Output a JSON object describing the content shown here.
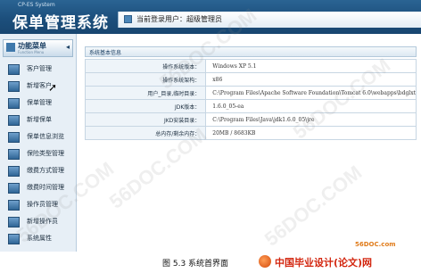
{
  "header": {
    "brand_small": "CP-ES System",
    "app_title": "保单管理系统",
    "current_user_label": "当前登录用户：超级管理员"
  },
  "sidebar": {
    "head_label": "功能菜单",
    "head_sub": "Function Menu",
    "items": [
      {
        "label": "客户管理",
        "icon": "customer-icon"
      },
      {
        "label": "新增客户",
        "icon": "add-customer-icon"
      },
      {
        "label": "保单管理",
        "icon": "policy-icon"
      },
      {
        "label": "新增保单",
        "icon": "add-policy-icon"
      },
      {
        "label": "保单信息浏览",
        "icon": "browse-icon"
      },
      {
        "label": "保险类型管理",
        "icon": "type-icon"
      },
      {
        "label": "缴费方式管理",
        "icon": "payment-icon"
      },
      {
        "label": "缴费时间管理",
        "icon": "schedule-icon"
      },
      {
        "label": "操作员管理",
        "icon": "operator-icon"
      },
      {
        "label": "新增操作员",
        "icon": "add-operator-icon"
      },
      {
        "label": "系统属性",
        "icon": "settings-icon"
      }
    ]
  },
  "main": {
    "section_title": "系统基本信息",
    "rows": [
      {
        "key": "操作系统版本：",
        "value": "Windows XP  5.1"
      },
      {
        "key": "操作系统架构：",
        "value": "x86"
      },
      {
        "key": "用户_目录,临时目录：",
        "value": "C:\\Program Files\\Apache Software Foundation\\Tomcat 6.0\\webapps\\bdglxt"
      },
      {
        "key": "JDK版本：",
        "value": "1.6.0_05-ea"
      },
      {
        "key": "JKD安装目录：",
        "value": "C:\\Program Files\\Java\\jdk1.6.0_05\\jre"
      },
      {
        "key": "总内存/剩余内存：",
        "value": "20MB  / 8683KB"
      }
    ]
  },
  "watermark": "56DOC.COM",
  "caption": {
    "figure_label": "图 5.3 系统首界面",
    "logo_text": "中国毕业设计(论文)网",
    "site": "56DOC.com"
  },
  "colors": {
    "header_blue": "#1c4f7c",
    "sidebar_bg": "#e7eff6",
    "logo_red": "#d3260f"
  }
}
